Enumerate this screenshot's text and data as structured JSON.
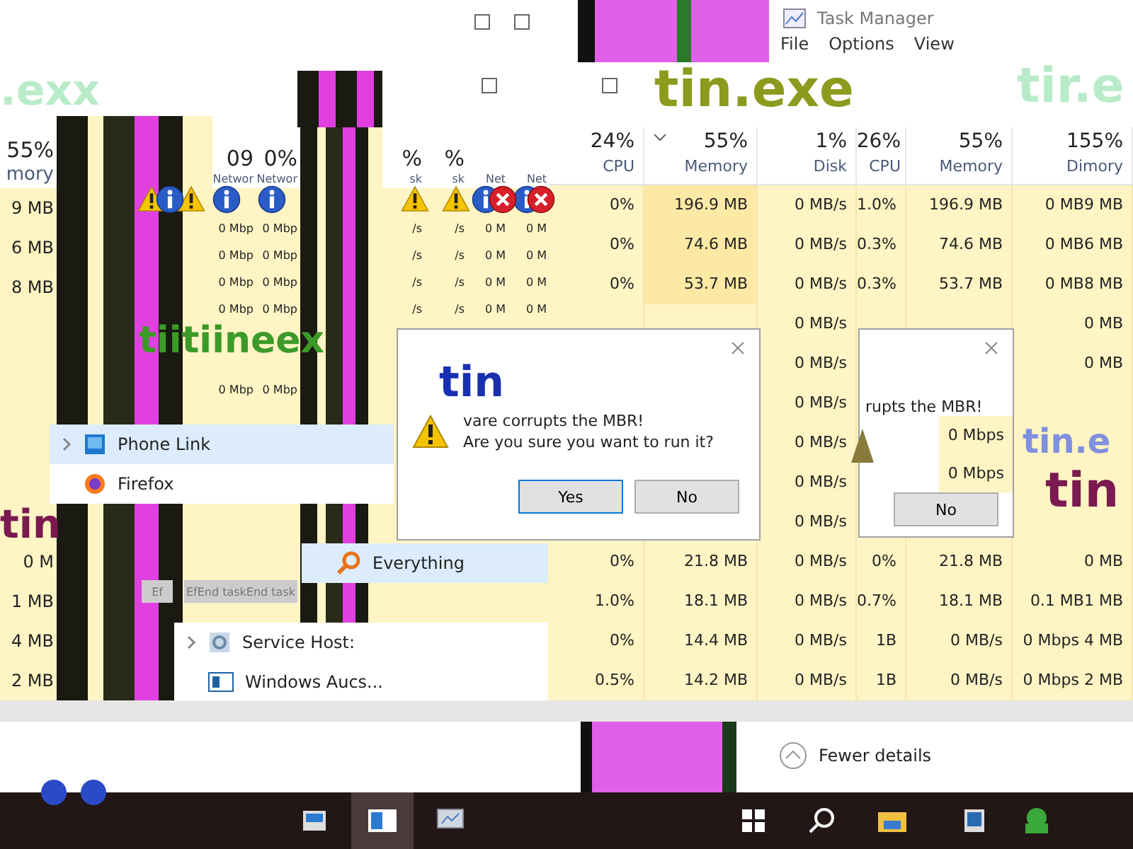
{
  "task_manager": {
    "title": "Task Manager",
    "menu": [
      "File",
      "Options",
      "View"
    ]
  },
  "malware_texts": [
    {
      "text": ".exx",
      "color": "#b8ecc8"
    },
    {
      "text": "tin.exe",
      "color": "#8c9a1e"
    },
    {
      "text": "tir.e",
      "color": "#b8ecc8"
    },
    {
      "text": "tiitiineex",
      "color": "#3c9a28"
    },
    {
      "text": "tin",
      "color": "#1830b0"
    },
    {
      "text": "tin",
      "color": "#7a1a50"
    },
    {
      "text": "tin.e",
      "color": "#8090e0"
    },
    {
      "text": "tin",
      "color": "#7a1a50"
    }
  ],
  "main_table": {
    "columns": [
      {
        "value": "24%",
        "label": "CPU",
        "sorted": false
      },
      {
        "value": "55%",
        "label": "Memory",
        "sorted": true
      },
      {
        "value": "1%",
        "label": "Disk",
        "sorted": false
      },
      {
        "value": "26%",
        "label": "CPU",
        "sorted": false
      },
      {
        "value": "55%",
        "label": "Memory",
        "sorted": false
      },
      {
        "value": "155%",
        "label": "Dimory",
        "sorted": false
      }
    ],
    "rows": [
      [
        "0%",
        "196.9 MB",
        "0 MB/s",
        "1.0%",
        "196.9 MB",
        "0 MB9 MB"
      ],
      [
        "0%",
        "74.6 MB",
        "0 MB/s",
        "0.3%",
        "74.6 MB",
        "0 MB6 MB"
      ],
      [
        "0%",
        "53.7 MB",
        "0 MB/s",
        "0.3%",
        "53.7 MB",
        "0 MB8 MB"
      ],
      [
        null,
        null,
        "0 MB/s",
        null,
        null,
        "0 MB"
      ],
      [
        null,
        null,
        "0 MB/s",
        null,
        null,
        "0 MB"
      ],
      [
        null,
        null,
        "0 MB/s",
        null,
        null,
        null
      ],
      [
        null,
        null,
        "0 MB/s",
        null,
        null,
        null
      ],
      [
        null,
        null,
        "0 MB/s",
        null,
        null,
        null
      ],
      [
        null,
        null,
        "0 MB/s",
        null,
        null,
        null
      ],
      [
        "0%",
        "21.8 MB",
        "0 MB/s",
        "0%",
        "21.8 MB",
        "0 MB"
      ],
      [
        "1.0%",
        "18.1 MB",
        "0 MB/s",
        "0.7%",
        "18.1 MB",
        "0.1 MB1 MB"
      ],
      [
        "0%",
        "14.4 MB",
        "0 MB/s",
        "1B",
        "0 MB/s",
        "0 Mbps 4 MB"
      ],
      [
        "0.5%",
        "14.2 MB",
        "0 MB/s",
        "1B",
        "0 MB/s",
        "0 Mbps 2 MB"
      ]
    ]
  },
  "left_table": {
    "columns": [
      {
        "kind": "wide",
        "value": "55%",
        "label": "mory",
        "cells": [
          "9 MB",
          "6 MB",
          "8 MB",
          null,
          null,
          null,
          null,
          null,
          null,
          "0 M",
          "1 MB",
          "4 MB",
          "2 MB"
        ]
      },
      {
        "kind": "glitch"
      },
      {
        "kind": "narrow",
        "value": "09",
        "label": "Networ",
        "cells": [
          null,
          "0 Mbp",
          "0 Mbp",
          "0 Mbp",
          "0 Mbp",
          null,
          null,
          "0 Mbp"
        ]
      },
      {
        "kind": "narrow",
        "value": "0%",
        "label": "Networ",
        "cells": [
          null,
          "0 Mbp",
          "0 Mbp",
          "0 Mbp",
          "0 Mbp",
          null,
          null,
          "0 Mbp"
        ]
      },
      {
        "kind": "glitch"
      },
      {
        "kind": "narrow",
        "value": "%",
        "label": "sk",
        "cells": [
          null,
          "/s",
          "/s",
          "/s",
          "/s"
        ]
      },
      {
        "kind": "narrow",
        "value": "%",
        "label": "sk",
        "cells": [
          null,
          "/s",
          "/s",
          "/s",
          "/s"
        ]
      },
      {
        "kind": "narrow",
        "label": "Net",
        "cells": [
          null,
          "0 M",
          "0 M",
          "0 M",
          "0 M"
        ]
      },
      {
        "kind": "narrow",
        "label": "Net",
        "cells": [
          null,
          "0 M",
          "0 M",
          "0 M",
          "0 M"
        ]
      }
    ]
  },
  "dialogs": [
    {
      "message": "vare corrupts the MBR!",
      "question": "Are you sure you want to run it?",
      "buttons": [
        "Yes",
        "No"
      ]
    },
    {
      "message": "rupts the MBR!",
      "readings": [
        "0 Mbps",
        "0 Mbps"
      ],
      "buttons": [
        "No"
      ]
    }
  ],
  "process_items": [
    {
      "label": "Phone Link",
      "expandable": true,
      "selected": true
    },
    {
      "label": "Firefox",
      "expandable": false,
      "selected": false
    },
    {
      "label": "Everything",
      "expandable": false,
      "selected": true
    },
    {
      "label": "Service Host:",
      "expandable": true,
      "selected": false
    },
    {
      "label": "Windows Aucs...",
      "expandable": false,
      "selected": false
    }
  ],
  "end_task_buttons": [
    "Ef",
    "EfEnd taskEnd task"
  ],
  "fewer_details": "Fewer details"
}
